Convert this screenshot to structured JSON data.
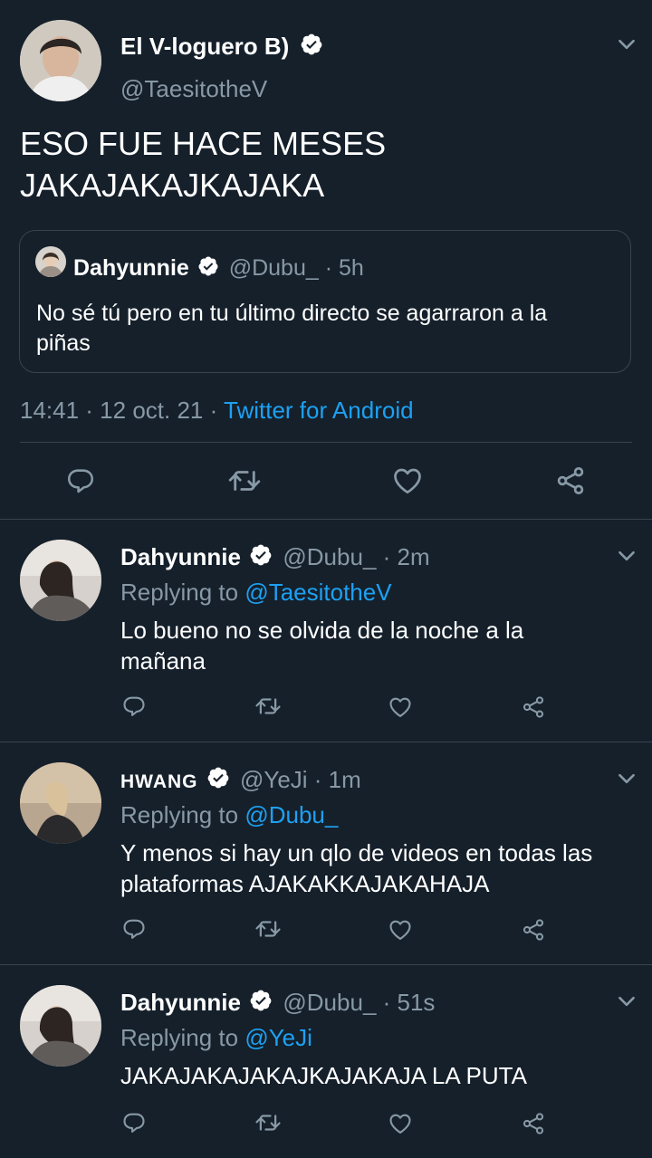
{
  "main_tweet": {
    "display_name": "El V-loguero B)",
    "handle": "@TaesitotheV",
    "text_line1": "ESO FUE HACE MESES",
    "text_line2": "JAKAJAKAJKAJAKA",
    "timestamp": "14:41 · 12 oct. 21 ·",
    "source": "Twitter for Android",
    "quoted": {
      "display_name": "Dahyunnie",
      "handle_time": "@Dubu_ · 5h",
      "text_line1": "No sé tú pero en tu último directo se agarraron a la",
      "text_line2": "piñas"
    }
  },
  "replies": [
    {
      "display_name": "Dahyunnie",
      "handle_time": "@Dubu_ · 2m",
      "replying_prefix": "Replying to",
      "replying_to": "@TaesitotheV",
      "text_line1": "Lo bueno no se olvida de la noche a la",
      "text_line2": "mañana"
    },
    {
      "display_name": "HWANG",
      "handle_time": "@YeJi · 1m",
      "replying_prefix": "Replying to",
      "replying_to": "@Dubu_",
      "text_line1": "Y menos si hay un qlo de videos en todas las",
      "text_line2": "plataformas AJAKAKKAJAKAHAJA"
    },
    {
      "display_name": "Dahyunnie",
      "handle_time": "@Dubu_ · 51s",
      "replying_prefix": "Replying to",
      "replying_to": "@YeJi",
      "text_line1": "JAKAJAKAJAKAJKAJAKAJA LA PUTA",
      "text_line2": ""
    }
  ],
  "icons": [
    "reply-icon",
    "retweet-icon",
    "like-icon",
    "share-icon",
    "verified-icon",
    "chevron-down-icon"
  ],
  "colors": {
    "background": "#15202b",
    "muted": "#8899a6",
    "link": "#1da1f2",
    "divider": "#38444d"
  }
}
